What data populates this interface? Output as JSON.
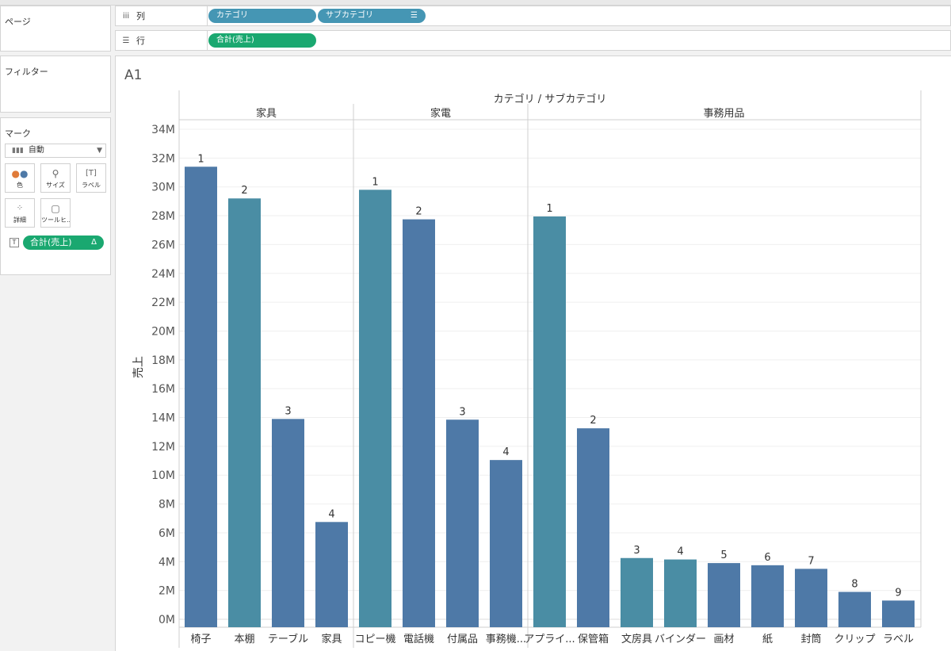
{
  "panels": {
    "pages_title": "ページ",
    "filters_title": "フィルター",
    "marks_title": "マーク"
  },
  "marks": {
    "type_label": "自動",
    "buttons": [
      "色",
      "サイズ",
      "ラベル",
      "詳細",
      "ツールヒ..."
    ],
    "field_pill": "合計(売上)",
    "field_pill_delta": "Δ"
  },
  "shelves": {
    "columns_label": "列",
    "columns_pills": [
      "カテゴリ",
      "サブカテゴリ"
    ],
    "rows_label": "行",
    "rows_pills": [
      "合計(売上)"
    ]
  },
  "sheet": {
    "title": "A1"
  },
  "colors": {
    "bar_blue": "#4e79a7",
    "bar_teal": "#4a8da4",
    "pill_blue": "#4596b4",
    "pill_green": "#1aa870"
  },
  "chart_data": {
    "type": "bar",
    "header_title": "カテゴリ / サブカテゴリ",
    "ylabel": "売上",
    "ylim": [
      0,
      34000000
    ],
    "yticks": [
      0,
      2000000,
      4000000,
      6000000,
      8000000,
      10000000,
      12000000,
      14000000,
      16000000,
      18000000,
      20000000,
      22000000,
      24000000,
      26000000,
      28000000,
      30000000,
      32000000,
      34000000
    ],
    "ytick_labels": [
      "0M",
      "2M",
      "4M",
      "6M",
      "8M",
      "10M",
      "12M",
      "14M",
      "16M",
      "18M",
      "20M",
      "22M",
      "24M",
      "26M",
      "28M",
      "30M",
      "32M",
      "34M"
    ],
    "grid": "horizontal",
    "panes": [
      {
        "category": "家具",
        "subcategories": [
          "椅子",
          "本棚",
          "テーブル",
          "家具"
        ],
        "values": [
          31400000,
          29200000,
          13900000,
          6750000
        ],
        "labels": [
          "1",
          "2",
          "3",
          "4"
        ],
        "colors": [
          "#4e79a7",
          "#4a8da4",
          "#4e79a7",
          "#4e79a7"
        ]
      },
      {
        "category": "家電",
        "subcategories": [
          "コピー機",
          "電話機",
          "付属品",
          "事務機..."
        ],
        "values": [
          29800000,
          27750000,
          13850000,
          11050000
        ],
        "labels": [
          "1",
          "2",
          "3",
          "4"
        ],
        "colors": [
          "#4a8da4",
          "#4e79a7",
          "#4e79a7",
          "#4e79a7"
        ]
      },
      {
        "category": "事務用品",
        "subcategories": [
          "アプライ...",
          "保管箱",
          "文房具",
          "バインダー",
          "画材",
          "紙",
          "封筒",
          "クリップ",
          "ラベル"
        ],
        "values": [
          27950000,
          13250000,
          4250000,
          4150000,
          3900000,
          3750000,
          3500000,
          1900000,
          1300000
        ],
        "labels": [
          "1",
          "2",
          "3",
          "4",
          "5",
          "6",
          "7",
          "8",
          "9"
        ],
        "colors": [
          "#4a8da4",
          "#4e79a7",
          "#4a8da4",
          "#4a8da4",
          "#4e79a7",
          "#4e79a7",
          "#4e79a7",
          "#4e79a7",
          "#4e79a7"
        ]
      }
    ]
  }
}
